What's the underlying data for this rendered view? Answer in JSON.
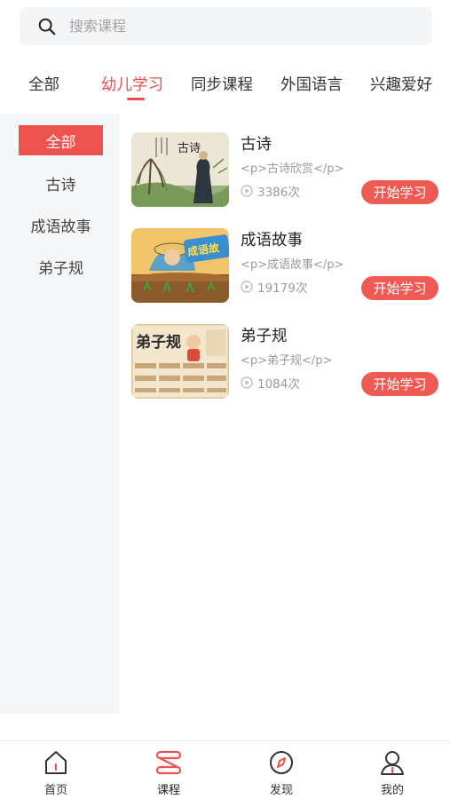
{
  "search": {
    "placeholder": "搜索课程",
    "icon": "search-icon"
  },
  "tabs": [
    {
      "label": "全部",
      "active": false
    },
    {
      "label": "幼儿学习",
      "active": true
    },
    {
      "label": "同步课程",
      "active": false
    },
    {
      "label": "外国语言",
      "active": false
    },
    {
      "label": "兴趣爱好",
      "active": false
    }
  ],
  "sidebar": {
    "items": [
      {
        "label": "全部",
        "active": true
      },
      {
        "label": "古诗",
        "active": false
      },
      {
        "label": "成语故事",
        "active": false
      },
      {
        "label": "弟子规",
        "active": false
      }
    ]
  },
  "courses": [
    {
      "title": "古诗",
      "desc": "<p>古诗欣赏</p>",
      "count": "3386次",
      "button": "开始学习",
      "thumb_text": "古诗"
    },
    {
      "title": "成语故事",
      "desc": "<p>成语故事</p>",
      "count": "19179次",
      "button": "开始学习",
      "thumb_text": "成语故"
    },
    {
      "title": "弟子规",
      "desc": "<p>弟子规</p>",
      "count": "1084次",
      "button": "开始学习",
      "thumb_text": "弟子规"
    }
  ],
  "bottom_nav": [
    {
      "label": "首页",
      "icon": "home-icon",
      "active": false
    },
    {
      "label": "课程",
      "icon": "courses-icon",
      "active": true
    },
    {
      "label": "发现",
      "icon": "compass-icon",
      "active": false
    },
    {
      "label": "我的",
      "icon": "user-icon",
      "active": false
    }
  ],
  "colors": {
    "accent": "#ef5350",
    "sidebar_bg": "#f5f6f8",
    "search_bg": "#f4f5f7"
  }
}
